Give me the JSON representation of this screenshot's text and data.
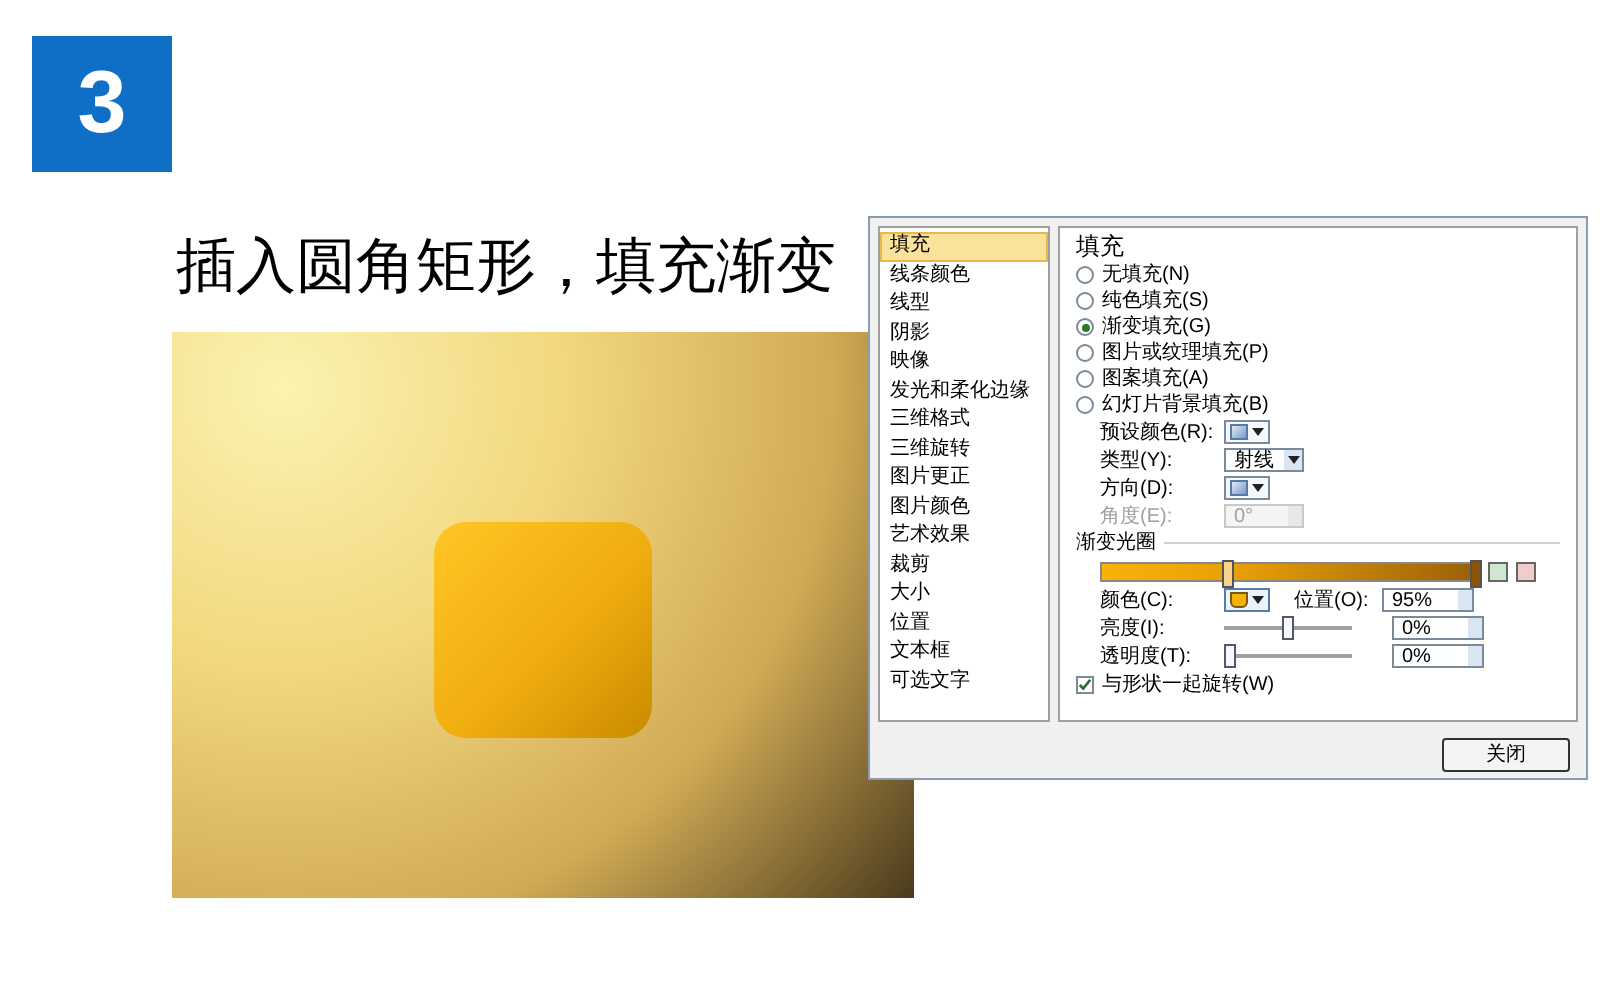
{
  "step_badge": "3",
  "heading": "插入圆角矩形，填充渐变",
  "dialog": {
    "sidebar": [
      {
        "label": "填充",
        "selected": true
      },
      {
        "label": "线条颜色",
        "selected": false
      },
      {
        "label": "线型",
        "selected": false
      },
      {
        "label": "阴影",
        "selected": false
      },
      {
        "label": "映像",
        "selected": false
      },
      {
        "label": "发光和柔化边缘",
        "selected": false
      },
      {
        "label": "三维格式",
        "selected": false
      },
      {
        "label": "三维旋转",
        "selected": false
      },
      {
        "label": "图片更正",
        "selected": false
      },
      {
        "label": "图片颜色",
        "selected": false
      },
      {
        "label": "艺术效果",
        "selected": false
      },
      {
        "label": "裁剪",
        "selected": false
      },
      {
        "label": "大小",
        "selected": false
      },
      {
        "label": "位置",
        "selected": false
      },
      {
        "label": "文本框",
        "selected": false
      },
      {
        "label": "可选文字",
        "selected": false
      }
    ],
    "pane_title": "填充",
    "fill_options": [
      {
        "label": "无填充(N)",
        "selected": false
      },
      {
        "label": "纯色填充(S)",
        "selected": false
      },
      {
        "label": "渐变填充(G)",
        "selected": true
      },
      {
        "label": "图片或纹理填充(P)",
        "selected": false
      },
      {
        "label": "图案填充(A)",
        "selected": false
      },
      {
        "label": "幻灯片背景填充(B)",
        "selected": false
      }
    ],
    "preset_color": {
      "label": "预设颜色(R):"
    },
    "type": {
      "label": "类型(Y):",
      "value": "射线"
    },
    "direction": {
      "label": "方向(D):"
    },
    "angle": {
      "label": "角度(E):",
      "value": "0°",
      "disabled": true
    },
    "gradient_stops_title": "渐变光圈",
    "color": {
      "label": "颜色(C):"
    },
    "position": {
      "label": "位置(O):",
      "value": "95%"
    },
    "brightness": {
      "label": "亮度(I):",
      "level": 0.5,
      "value": "0%"
    },
    "transparency": {
      "label": "透明度(T):",
      "level": 0,
      "value": "0%"
    },
    "rotate_with_shape": {
      "label": "与形状一起旋转(W)",
      "checked": true
    },
    "close_button": "关闭"
  }
}
